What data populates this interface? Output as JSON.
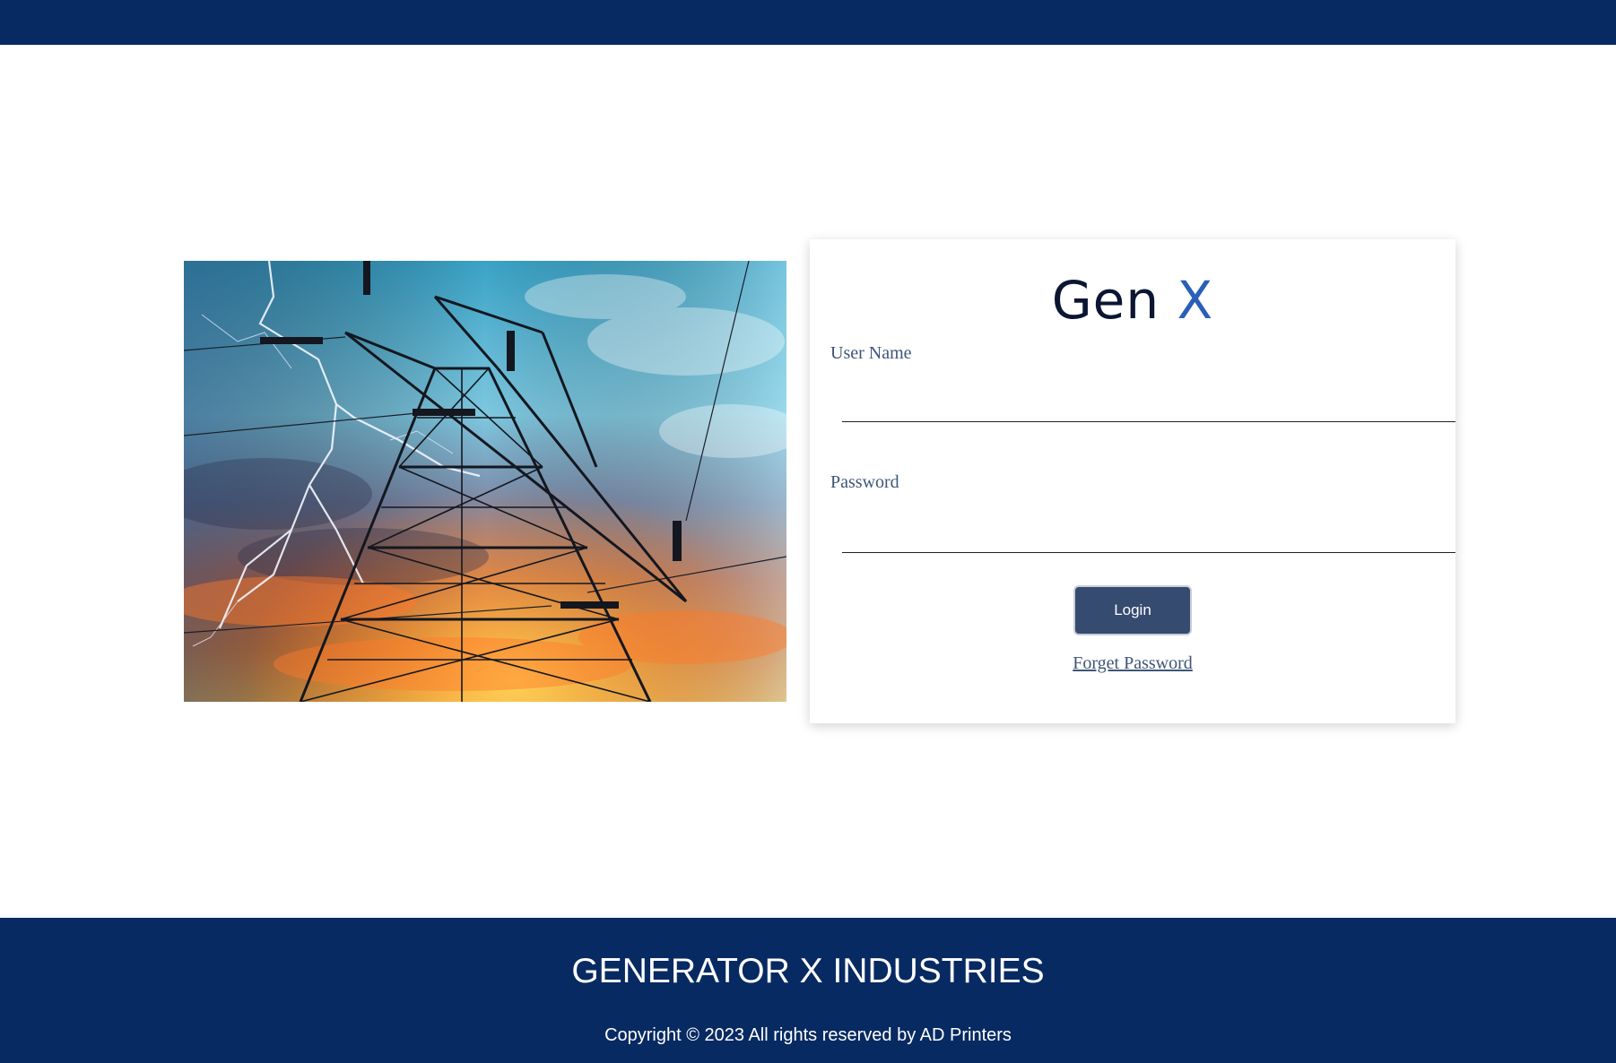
{
  "header": {
    "color": "#072a62"
  },
  "hero_image": {
    "icon": "power-tower-lightning-image"
  },
  "login": {
    "logo_text_gen": "Gen",
    "logo_text_x": "X",
    "username_label": "User Name",
    "username_value": "",
    "password_label": "Password",
    "password_value": "",
    "login_button_label": "Login",
    "forget_password_link": "Forget Password"
  },
  "footer": {
    "title": "GENERATOR X INDUSTRIES",
    "copyright": "Copyright © 2023 All rights reserved by AD Printers"
  },
  "colors": {
    "brand_navy": "#072a62",
    "button_bg": "#354b70",
    "label_text": "#3e5578",
    "logo_dark": "#0b1633",
    "logo_accent": "#2a5fb8"
  }
}
